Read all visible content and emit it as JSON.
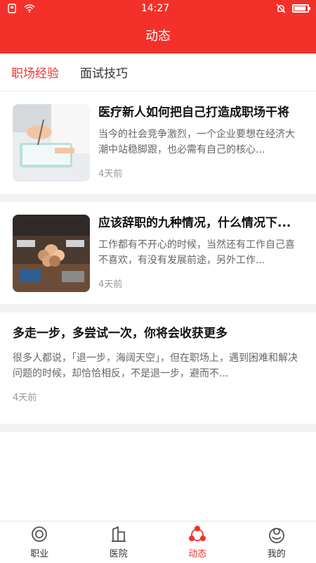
{
  "status_bar": {
    "time": "14:27",
    "icons": [
      "sim-icon",
      "wifi-icon",
      "mute-icon",
      "battery-icon"
    ],
    "background": "#f3312a"
  },
  "header": {
    "title": "动态"
  },
  "tabs": [
    {
      "label": "职场经验",
      "active": true
    },
    {
      "label": "面试技巧",
      "active": false
    }
  ],
  "articles": [
    {
      "title": "医疗新人如何把自己打造成职场干将",
      "summary": "当今的社会竞争激烈，一个企业要想在经济大潮中站稳脚跟，也必需有自己的核心...",
      "time": "4天前",
      "thumbnail": "medical-thumbnail"
    },
    {
      "title": "应该辞职的九种情况，什么情况下...",
      "summary": "工作都有不开心的时候，当然还有工作自己喜不喜欢，有没有发展前途，另外工作...",
      "time": "4天前",
      "thumbnail": "team-fists-thumbnail"
    },
    {
      "title": "多走一步，多尝试一次，你将会收获更多",
      "summary": "很多人都说，「退一步，海阔天空」，但在职场上，遇到困难和解决问题的时候，却恰恰相反，不是退一步，避而不...",
      "time": "4天前"
    }
  ],
  "bottom_nav": [
    {
      "label": "职业",
      "icon": "target-icon",
      "active": false
    },
    {
      "label": "医院",
      "icon": "hospital-icon",
      "active": false
    },
    {
      "label": "动态",
      "icon": "network-icon",
      "active": true
    },
    {
      "label": "我的",
      "icon": "user-icon",
      "active": false
    }
  ],
  "colors": {
    "accent": "#f3312a",
    "muted": "#999999",
    "separator": "#f2f2f2"
  }
}
